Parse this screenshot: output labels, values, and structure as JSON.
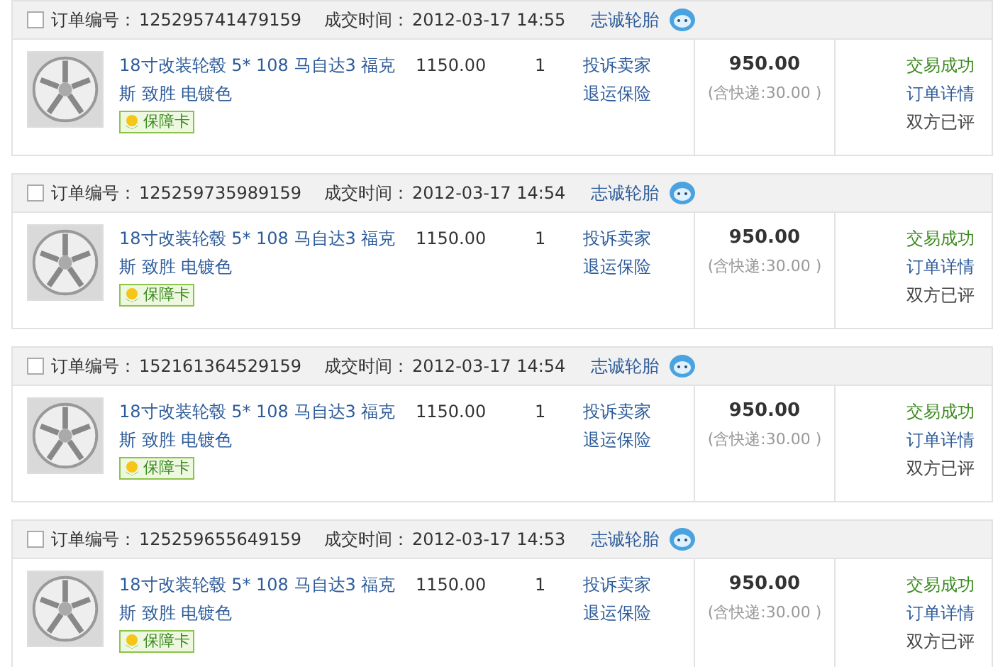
{
  "orders": [
    {
      "checked": false,
      "order_no_label": "订单编号：",
      "order_no": "125295741479159",
      "time_label": "成交时间：",
      "time": "2012-03-17 14:55",
      "seller": "志诚轮胎",
      "item": {
        "title": "18寸改装轮毂 5* 108 马自达3 福克斯 致胜 电镀色",
        "badge": "保障卡",
        "price": "1150.00",
        "quantity": "1"
      },
      "actions": [
        "投诉卖家",
        "退运保险"
      ],
      "total": "950.00",
      "shipping": "(含快递:30.00 )",
      "status": [
        {
          "kind": "state",
          "text": "交易成功"
        },
        {
          "kind": "link",
          "text": "订单详情"
        },
        {
          "kind": "note",
          "text": "双方已评"
        }
      ]
    },
    {
      "checked": false,
      "order_no_label": "订单编号：",
      "order_no": "125259735989159",
      "time_label": "成交时间：",
      "time": "2012-03-17 14:54",
      "seller": "志诚轮胎",
      "item": {
        "title": "18寸改装轮毂 5* 108 马自达3 福克斯 致胜 电镀色",
        "badge": "保障卡",
        "price": "1150.00",
        "quantity": "1"
      },
      "actions": [
        "投诉卖家",
        "退运保险"
      ],
      "total": "950.00",
      "shipping": "(含快递:30.00 )",
      "status": [
        {
          "kind": "state",
          "text": "交易成功"
        },
        {
          "kind": "link",
          "text": "订单详情"
        },
        {
          "kind": "note",
          "text": "双方已评"
        }
      ]
    },
    {
      "checked": false,
      "order_no_label": "订单编号：",
      "order_no": "152161364529159",
      "time_label": "成交时间：",
      "time": "2012-03-17 14:54",
      "seller": "志诚轮胎",
      "item": {
        "title": "18寸改装轮毂 5* 108 马自达3 福克斯 致胜 电镀色",
        "badge": "保障卡",
        "price": "1150.00",
        "quantity": "1"
      },
      "actions": [
        "投诉卖家",
        "退运保险"
      ],
      "total": "950.00",
      "shipping": "(含快递:30.00 )",
      "status": [
        {
          "kind": "state",
          "text": "交易成功"
        },
        {
          "kind": "link",
          "text": "订单详情"
        },
        {
          "kind": "note",
          "text": "双方已评"
        }
      ]
    },
    {
      "checked": false,
      "order_no_label": "订单编号：",
      "order_no": "125259655649159",
      "time_label": "成交时间：",
      "time": "2012-03-17 14:53",
      "seller": "志诚轮胎",
      "item": {
        "title": "18寸改装轮毂 5* 108 马自达3 福克斯 致胜 电镀色",
        "badge": "保障卡",
        "price": "1150.00",
        "quantity": "1"
      },
      "actions": [
        "投诉卖家",
        "退运保险"
      ],
      "total": "950.00",
      "shipping": "(含快递:30.00 )",
      "status": [
        {
          "kind": "state",
          "text": "交易成功"
        },
        {
          "kind": "link",
          "text": "订单详情"
        },
        {
          "kind": "note",
          "text": "双方已评"
        }
      ]
    }
  ]
}
